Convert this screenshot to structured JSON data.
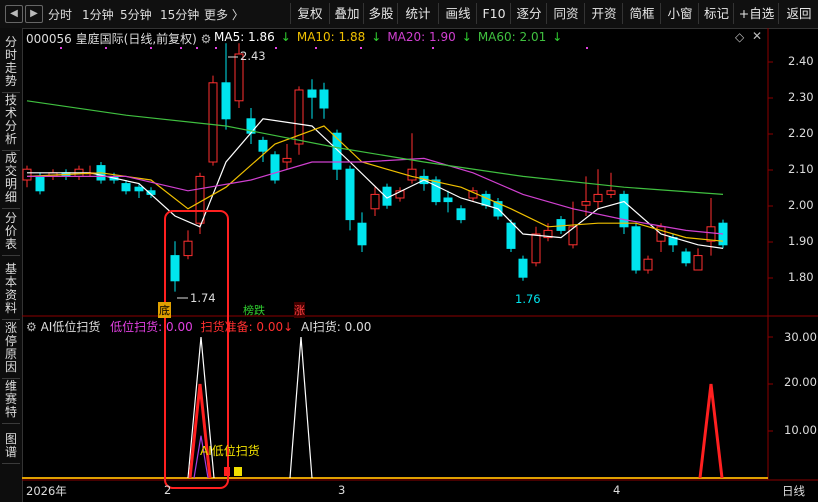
{
  "toolbar": {
    "nav_left": "◀",
    "nav_right": "▶",
    "periods": [
      "分时",
      "1分钟",
      "5分钟",
      "15分钟",
      "更多 〉"
    ],
    "buttons": [
      "复权",
      "叠加",
      "多股",
      "统计",
      "画线",
      "F10",
      "逐分",
      "同资",
      "开资",
      "简框",
      "小窗",
      "标记",
      "+自选",
      "返回"
    ]
  },
  "sidebar": [
    "分时走势",
    "技术分析",
    "成交明细",
    "分价表",
    "基本资料",
    "涨停原因",
    "维赛特",
    "图谱"
  ],
  "stock": {
    "code": "000056",
    "name": "皇庭国际",
    "mode": "(日线,前复权)"
  },
  "ma_legend": [
    {
      "label": "MA5: 1.86",
      "arrow": "↓",
      "color": "#ffffff"
    },
    {
      "label": "MA10: 1.88",
      "arrow": "↓",
      "color": "#f0c000"
    },
    {
      "label": "MA20: 1.90",
      "arrow": "↓",
      "color": "#d040d0"
    },
    {
      "label": "MA60: 2.01",
      "arrow": "↓",
      "color": "#40c040"
    }
  ],
  "price_axis": [
    "2.40",
    "2.30",
    "2.20",
    "2.10",
    "2.00",
    "1.90",
    "1.80"
  ],
  "annotations": {
    "high": "2.43",
    "low": "1.74",
    "low2": "1.76"
  },
  "markers": [
    {
      "text": "底",
      "color": "#e0a000"
    },
    {
      "text": "榜跌",
      "color": "#30d030"
    },
    {
      "text": "涨",
      "color": "#ff4040"
    }
  ],
  "indicator": {
    "name": "AI低位扫货",
    "lines": [
      {
        "label": "低位扫货: 0.00",
        "color": "#e040e0"
      },
      {
        "label": "扫货准备: 0.00",
        "color": "#ff3030"
      },
      {
        "label": "AI扫货: 0.00",
        "color": "#ffffff"
      }
    ],
    "axis": [
      "30.00",
      "20.00",
      "10.00"
    ],
    "signal_text": "AI低位扫货"
  },
  "x_axis": [
    "2026年",
    "2",
    "3",
    "4"
  ],
  "period_label": "日线",
  "colors": {
    "up": "#ff3030",
    "down": "#00e5ee",
    "frame": "#ff2020"
  },
  "chart_data": {
    "type": "candlestick",
    "price_range": [
      1.74,
      2.43
    ],
    "indicator_range": [
      0,
      30
    ]
  }
}
